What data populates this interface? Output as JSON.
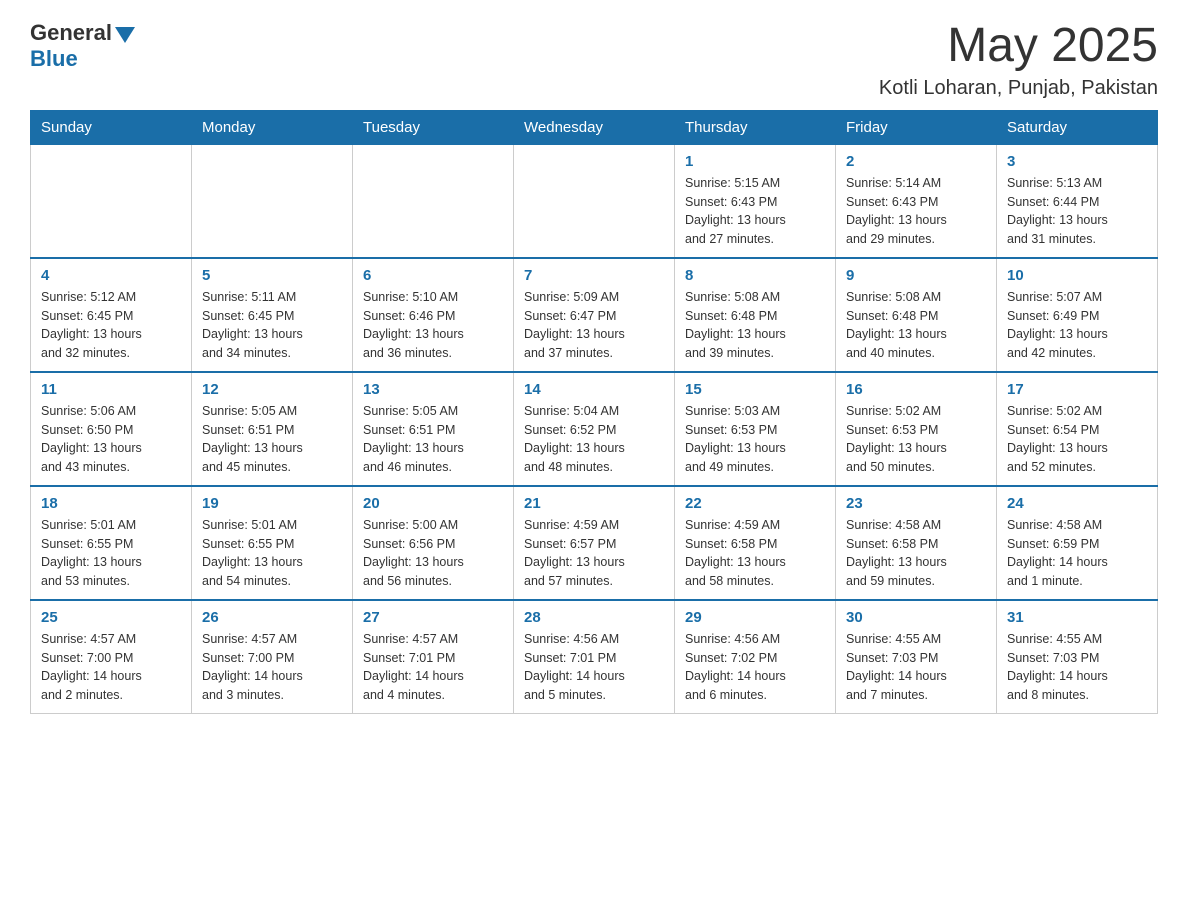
{
  "header": {
    "logo_general": "General",
    "logo_blue": "Blue",
    "month_year": "May 2025",
    "location": "Kotli Loharan, Punjab, Pakistan"
  },
  "weekdays": [
    "Sunday",
    "Monday",
    "Tuesday",
    "Wednesday",
    "Thursday",
    "Friday",
    "Saturday"
  ],
  "weeks": [
    [
      {
        "day": "",
        "info": ""
      },
      {
        "day": "",
        "info": ""
      },
      {
        "day": "",
        "info": ""
      },
      {
        "day": "",
        "info": ""
      },
      {
        "day": "1",
        "info": "Sunrise: 5:15 AM\nSunset: 6:43 PM\nDaylight: 13 hours\nand 27 minutes."
      },
      {
        "day": "2",
        "info": "Sunrise: 5:14 AM\nSunset: 6:43 PM\nDaylight: 13 hours\nand 29 minutes."
      },
      {
        "day": "3",
        "info": "Sunrise: 5:13 AM\nSunset: 6:44 PM\nDaylight: 13 hours\nand 31 minutes."
      }
    ],
    [
      {
        "day": "4",
        "info": "Sunrise: 5:12 AM\nSunset: 6:45 PM\nDaylight: 13 hours\nand 32 minutes."
      },
      {
        "day": "5",
        "info": "Sunrise: 5:11 AM\nSunset: 6:45 PM\nDaylight: 13 hours\nand 34 minutes."
      },
      {
        "day": "6",
        "info": "Sunrise: 5:10 AM\nSunset: 6:46 PM\nDaylight: 13 hours\nand 36 minutes."
      },
      {
        "day": "7",
        "info": "Sunrise: 5:09 AM\nSunset: 6:47 PM\nDaylight: 13 hours\nand 37 minutes."
      },
      {
        "day": "8",
        "info": "Sunrise: 5:08 AM\nSunset: 6:48 PM\nDaylight: 13 hours\nand 39 minutes."
      },
      {
        "day": "9",
        "info": "Sunrise: 5:08 AM\nSunset: 6:48 PM\nDaylight: 13 hours\nand 40 minutes."
      },
      {
        "day": "10",
        "info": "Sunrise: 5:07 AM\nSunset: 6:49 PM\nDaylight: 13 hours\nand 42 minutes."
      }
    ],
    [
      {
        "day": "11",
        "info": "Sunrise: 5:06 AM\nSunset: 6:50 PM\nDaylight: 13 hours\nand 43 minutes."
      },
      {
        "day": "12",
        "info": "Sunrise: 5:05 AM\nSunset: 6:51 PM\nDaylight: 13 hours\nand 45 minutes."
      },
      {
        "day": "13",
        "info": "Sunrise: 5:05 AM\nSunset: 6:51 PM\nDaylight: 13 hours\nand 46 minutes."
      },
      {
        "day": "14",
        "info": "Sunrise: 5:04 AM\nSunset: 6:52 PM\nDaylight: 13 hours\nand 48 minutes."
      },
      {
        "day": "15",
        "info": "Sunrise: 5:03 AM\nSunset: 6:53 PM\nDaylight: 13 hours\nand 49 minutes."
      },
      {
        "day": "16",
        "info": "Sunrise: 5:02 AM\nSunset: 6:53 PM\nDaylight: 13 hours\nand 50 minutes."
      },
      {
        "day": "17",
        "info": "Sunrise: 5:02 AM\nSunset: 6:54 PM\nDaylight: 13 hours\nand 52 minutes."
      }
    ],
    [
      {
        "day": "18",
        "info": "Sunrise: 5:01 AM\nSunset: 6:55 PM\nDaylight: 13 hours\nand 53 minutes."
      },
      {
        "day": "19",
        "info": "Sunrise: 5:01 AM\nSunset: 6:55 PM\nDaylight: 13 hours\nand 54 minutes."
      },
      {
        "day": "20",
        "info": "Sunrise: 5:00 AM\nSunset: 6:56 PM\nDaylight: 13 hours\nand 56 minutes."
      },
      {
        "day": "21",
        "info": "Sunrise: 4:59 AM\nSunset: 6:57 PM\nDaylight: 13 hours\nand 57 minutes."
      },
      {
        "day": "22",
        "info": "Sunrise: 4:59 AM\nSunset: 6:58 PM\nDaylight: 13 hours\nand 58 minutes."
      },
      {
        "day": "23",
        "info": "Sunrise: 4:58 AM\nSunset: 6:58 PM\nDaylight: 13 hours\nand 59 minutes."
      },
      {
        "day": "24",
        "info": "Sunrise: 4:58 AM\nSunset: 6:59 PM\nDaylight: 14 hours\nand 1 minute."
      }
    ],
    [
      {
        "day": "25",
        "info": "Sunrise: 4:57 AM\nSunset: 7:00 PM\nDaylight: 14 hours\nand 2 minutes."
      },
      {
        "day": "26",
        "info": "Sunrise: 4:57 AM\nSunset: 7:00 PM\nDaylight: 14 hours\nand 3 minutes."
      },
      {
        "day": "27",
        "info": "Sunrise: 4:57 AM\nSunset: 7:01 PM\nDaylight: 14 hours\nand 4 minutes."
      },
      {
        "day": "28",
        "info": "Sunrise: 4:56 AM\nSunset: 7:01 PM\nDaylight: 14 hours\nand 5 minutes."
      },
      {
        "day": "29",
        "info": "Sunrise: 4:56 AM\nSunset: 7:02 PM\nDaylight: 14 hours\nand 6 minutes."
      },
      {
        "day": "30",
        "info": "Sunrise: 4:55 AM\nSunset: 7:03 PM\nDaylight: 14 hours\nand 7 minutes."
      },
      {
        "day": "31",
        "info": "Sunrise: 4:55 AM\nSunset: 7:03 PM\nDaylight: 14 hours\nand 8 minutes."
      }
    ]
  ]
}
